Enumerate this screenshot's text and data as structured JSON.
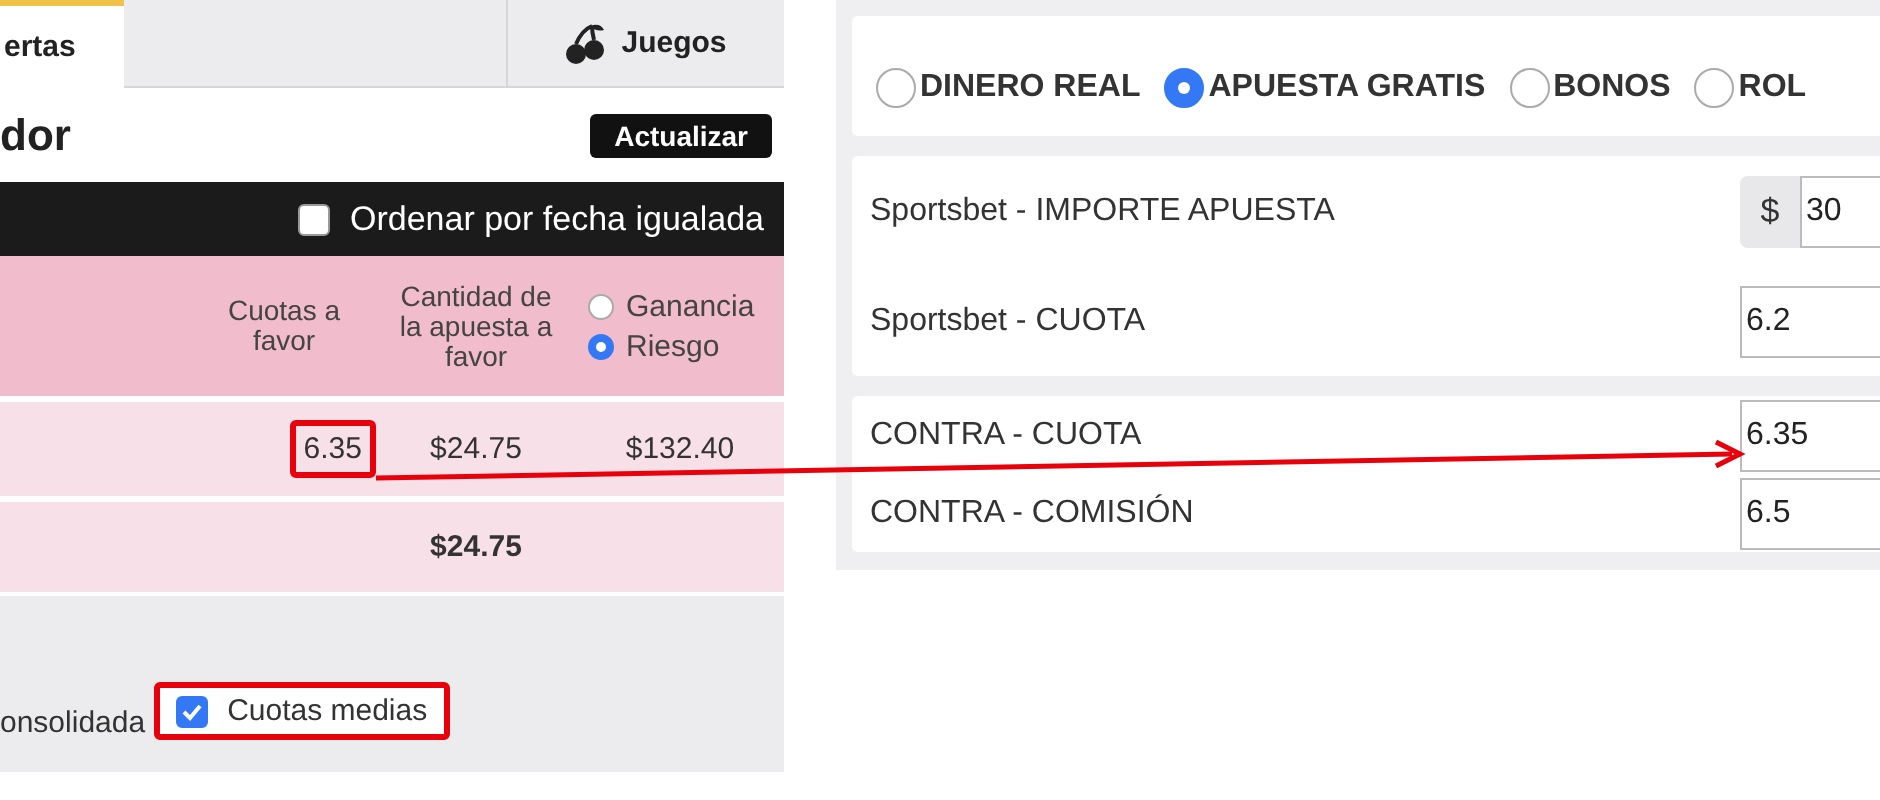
{
  "left_panel": {
    "tabs": [
      {
        "label": "ertas",
        "selected": true
      },
      {
        "label": "Juegos",
        "selected": false
      }
    ],
    "title": "dor",
    "refresh_button": "Actualizar",
    "sort_option": {
      "label": "Ordenar por fecha igualada",
      "checked": false
    },
    "table": {
      "columns": [
        "Cuotas a favor",
        "Cantidad de la apuesta a favor"
      ],
      "mode_options": [
        {
          "label": "Ganancia",
          "selected": false
        },
        {
          "label": "Riesgo",
          "selected": true
        }
      ],
      "rows": [
        {
          "cells": [
            {
              "text": "6.35",
              "highlighted": true
            },
            {
              "text": "$24.75",
              "highlighted": false
            },
            {
              "text": "$132.40",
              "highlighted": false
            }
          ]
        }
      ],
      "total": "$24.75"
    },
    "footer": {
      "label": "onsolidada",
      "average_odds": {
        "label": "Cuotas medias",
        "checked": true,
        "highlighted": true
      }
    }
  },
  "right_panel": {
    "bet_types": [
      {
        "label": "DINERO REAL",
        "selected": false
      },
      {
        "label": "APUESTA GRATIS",
        "selected": true
      },
      {
        "label": "BONOS",
        "selected": false
      },
      {
        "label": "ROL",
        "selected": false
      }
    ],
    "groups": [
      {
        "fields": [
          {
            "label": "Sportsbet - IMPORTE APUESTA",
            "prefix": "$",
            "value": "30"
          },
          {
            "label": "Sportsbet - CUOTA",
            "value": "6.2"
          }
        ]
      },
      {
        "fields": [
          {
            "label": "CONTRA - CUOTA",
            "value": "6.35"
          },
          {
            "label": "CONTRA - COMISIÓN",
            "value": "6.5"
          }
        ]
      }
    ]
  }
}
